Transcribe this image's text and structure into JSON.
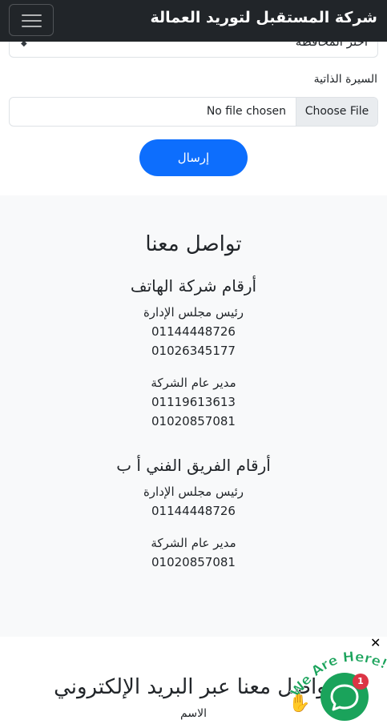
{
  "navbar": {
    "brand": "شركة المستقبل لتوريد العمالة",
    "toggler_icon": "hamburger-icon"
  },
  "form": {
    "governorate_select_value": "اختر المحافظة",
    "cv_label": "السيرة الذاتية",
    "file_status": "No file chosen",
    "file_button": "Choose File",
    "submit_label": "إرسال"
  },
  "contact": {
    "title": "تواصل معنا",
    "groups": [
      {
        "heading": "أرقام شركة الهاتف",
        "people": [
          {
            "role": "رئيس مجلس الإدارة",
            "phones": [
              "01144448726",
              "01026345177"
            ]
          },
          {
            "role": "مدير عام الشركة",
            "phones": [
              "01119613613",
              "01020857081"
            ]
          }
        ]
      },
      {
        "heading": "أرقام الفريق الفني أ ب",
        "people": [
          {
            "role": "رئيس مجلس الإدارة",
            "phones": [
              "01144448726"
            ]
          },
          {
            "role": "مدير عام الشركة",
            "phones": [
              "01020857081"
            ]
          }
        ]
      }
    ]
  },
  "email_section": {
    "heading": "تواصل معنا عبر البريد الإلكتروني",
    "name_label": "الاسم"
  },
  "chat_widget": {
    "tagline": "We Are Here!",
    "badge_count": "1",
    "close_symbol": "✕",
    "icon": "chat-icon",
    "colors": {
      "bubble": "#1aa35b",
      "badge": "#dc3545",
      "tagline": "#1aa35b"
    }
  },
  "colors": {
    "navbar_bg": "#212529",
    "primary": "#0d6efd",
    "section_bg": "#f8f9fa"
  }
}
